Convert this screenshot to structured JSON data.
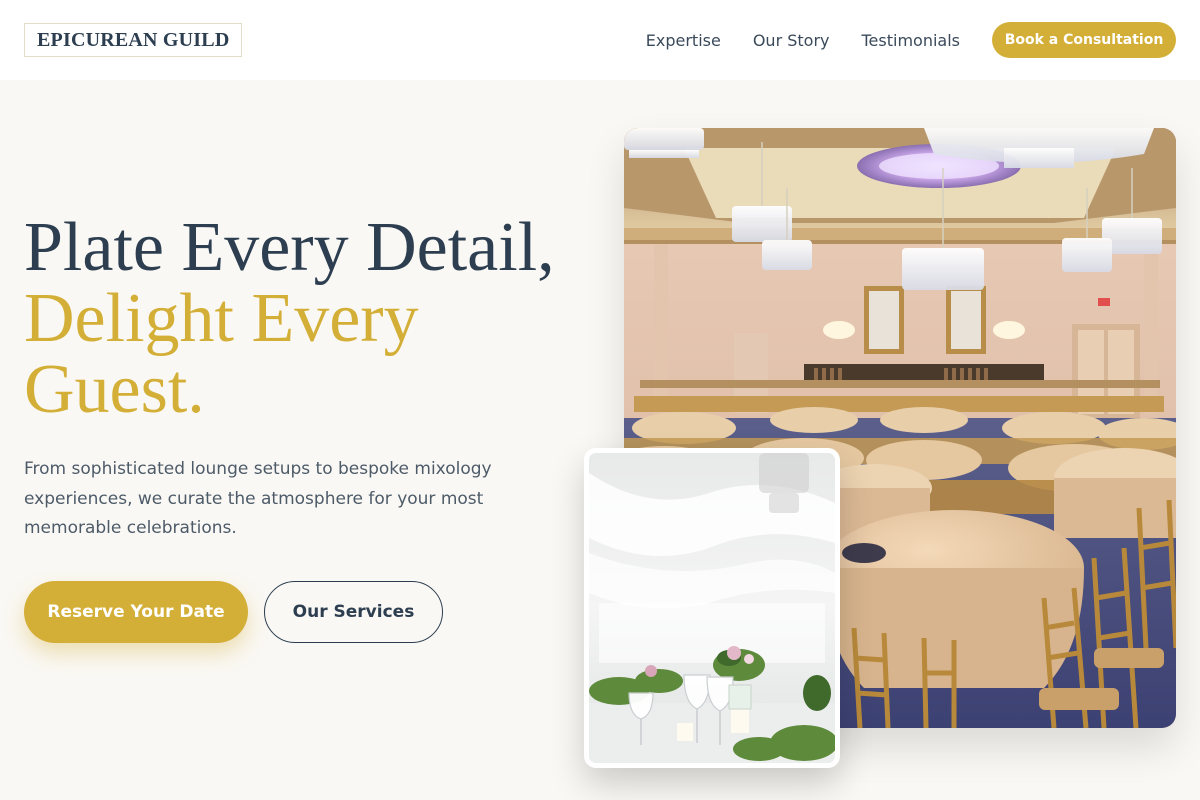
{
  "brand": {
    "name": "EPICUREAN GUILD"
  },
  "nav": {
    "links": [
      "Expertise",
      "Our Story",
      "Testimonials"
    ],
    "cta_label": "Book a Consultation"
  },
  "hero": {
    "title_line1": "Plate Every Detail,",
    "title_line2": "Delight Every",
    "title_line3": "Guest.",
    "description": "From sophisticated lounge setups to bespoke mixology experiences, we curate the atmosphere for your most memorable celebrations.",
    "primary_button": "Reserve Your Date",
    "secondary_button": "Our Services"
  },
  "images": {
    "main": "ballroom-photo",
    "secondary": "table-setting-photo"
  },
  "colors": {
    "accent": "#d4af37",
    "text_dark": "#2c3e50",
    "background": "#faf8f4"
  }
}
